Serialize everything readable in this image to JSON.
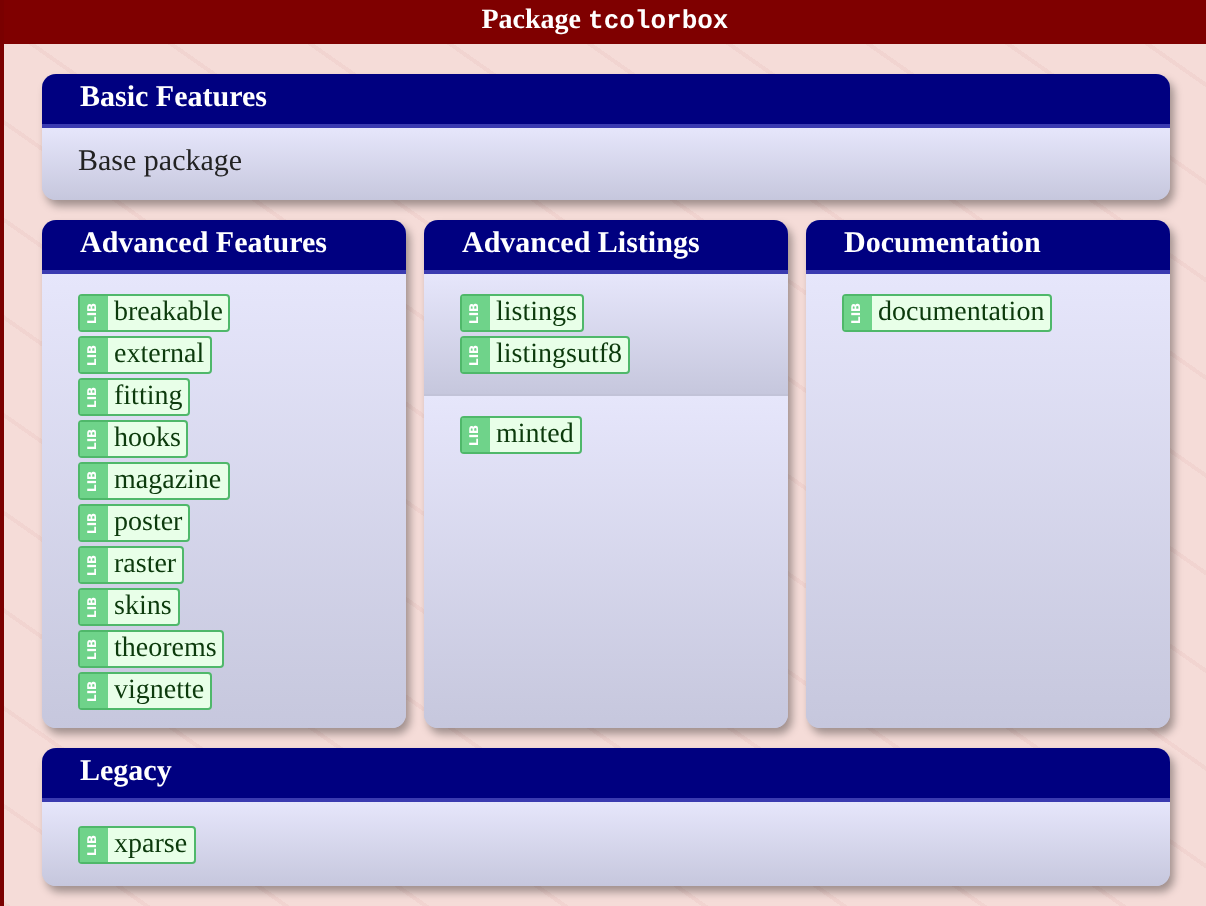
{
  "window": {
    "title": "Package",
    "title_code": "tcolorbox"
  },
  "rows": [
    {
      "boxes": [
        {
          "kind": "text",
          "title": "Basic Features",
          "text": "Base package"
        }
      ]
    },
    {
      "boxes": [
        {
          "kind": "libraries",
          "title": "Advanced Features",
          "sections": [
            {
              "libraries": [
                {
                  "tag": "LIB",
                  "name": "breakable"
                },
                {
                  "tag": "LIB",
                  "name": "external"
                },
                {
                  "tag": "LIB",
                  "name": "fitting"
                },
                {
                  "tag": "LIB",
                  "name": "hooks"
                },
                {
                  "tag": "LIB",
                  "name": "magazine"
                },
                {
                  "tag": "LIB",
                  "name": "poster"
                },
                {
                  "tag": "LIB",
                  "name": "raster"
                },
                {
                  "tag": "LIB",
                  "name": "skins"
                },
                {
                  "tag": "LIB",
                  "name": "theorems"
                },
                {
                  "tag": "LIB",
                  "name": "vignette"
                }
              ]
            }
          ]
        },
        {
          "kind": "libraries",
          "title": "Advanced Listings",
          "sections": [
            {
              "libraries": [
                {
                  "tag": "LIB",
                  "name": "listings"
                },
                {
                  "tag": "LIB",
                  "name": "listingsutf8"
                }
              ]
            },
            {
              "libraries": [
                {
                  "tag": "LIB",
                  "name": "minted"
                }
              ]
            }
          ]
        },
        {
          "kind": "libraries",
          "title": "Documentation",
          "sections": [
            {
              "libraries": [
                {
                  "tag": "LIB",
                  "name": "documentation"
                }
              ]
            }
          ]
        }
      ]
    },
    {
      "boxes": [
        {
          "kind": "libraries",
          "title": "Legacy",
          "sections": [
            {
              "libraries": [
                {
                  "tag": "LIB",
                  "name": "xparse"
                }
              ]
            }
          ]
        }
      ]
    }
  ]
}
